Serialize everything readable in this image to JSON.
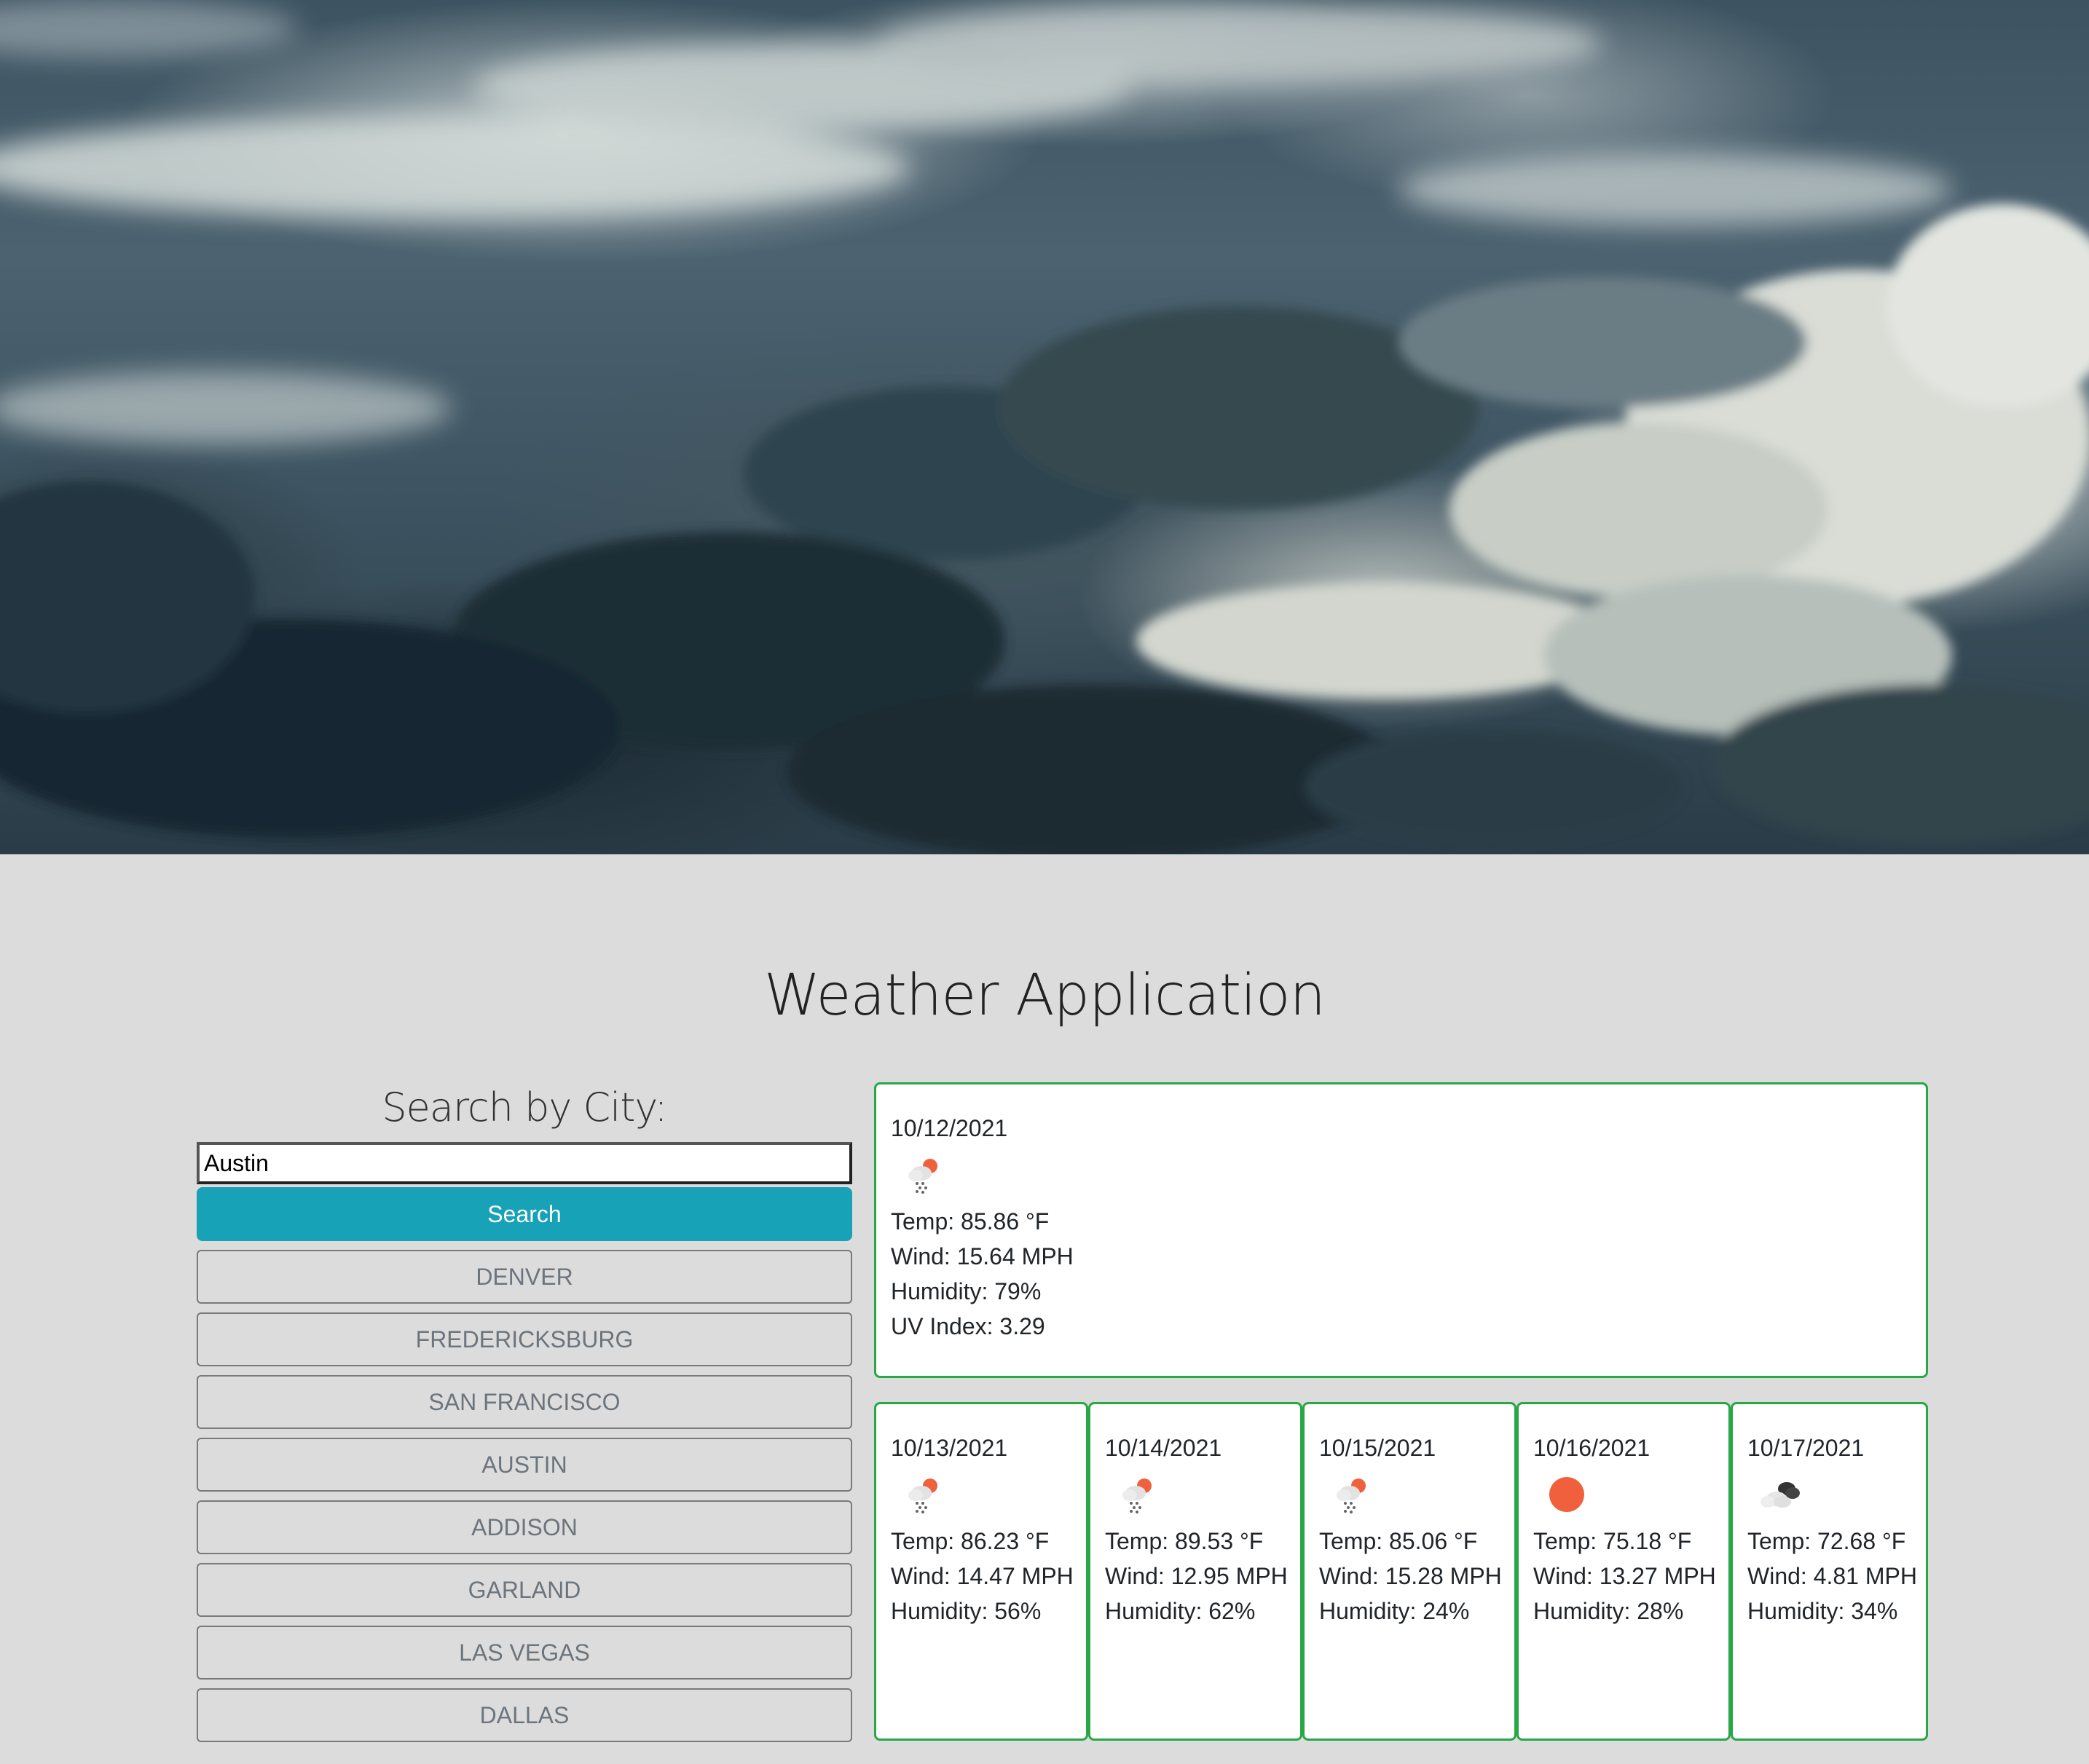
{
  "app": {
    "title": "Weather Application"
  },
  "search": {
    "heading": "Search by City:",
    "input_value": "Austin",
    "button_label": "Search"
  },
  "history": [
    "DENVER",
    "FREDERICKSBURG",
    "SAN FRANCISCO",
    "AUSTIN",
    "ADDISON",
    "GARLAND",
    "LAS VEGAS",
    "DALLAS"
  ],
  "current": {
    "date": "10/12/2021",
    "icon": "rain-sun-icon",
    "temp": "Temp: 85.86 °F",
    "wind": "Wind: 15.64 MPH",
    "humidity": "Humidity: 79%",
    "uv": "UV Index: 3.29"
  },
  "forecast": [
    {
      "date": "10/13/2021",
      "icon": "rain-sun-icon",
      "temp": "Temp: 86.23 °F",
      "wind": "Wind: 14.47 MPH",
      "humidity": "Humidity: 56%"
    },
    {
      "date": "10/14/2021",
      "icon": "rain-sun-icon",
      "temp": "Temp: 89.53 °F",
      "wind": "Wind: 12.95 MPH",
      "humidity": "Humidity: 62%"
    },
    {
      "date": "10/15/2021",
      "icon": "rain-sun-icon",
      "temp": "Temp: 85.06 °F",
      "wind": "Wind: 15.28 MPH",
      "humidity": "Humidity: 24%"
    },
    {
      "date": "10/16/2021",
      "icon": "sun-icon",
      "temp": "Temp: 75.18 °F",
      "wind": "Wind: 13.27 MPH",
      "humidity": "Humidity: 28%"
    },
    {
      "date": "10/17/2021",
      "icon": "clouds-icon",
      "temp": "Temp: 72.68 °F",
      "wind": "Wind: 4.81 MPH",
      "humidity": "Humidity: 34%"
    }
  ],
  "colors": {
    "accent": "#17a2b8",
    "card_border": "#28a745",
    "sun": "#f0603c",
    "page_background": "#dcdcdc"
  }
}
